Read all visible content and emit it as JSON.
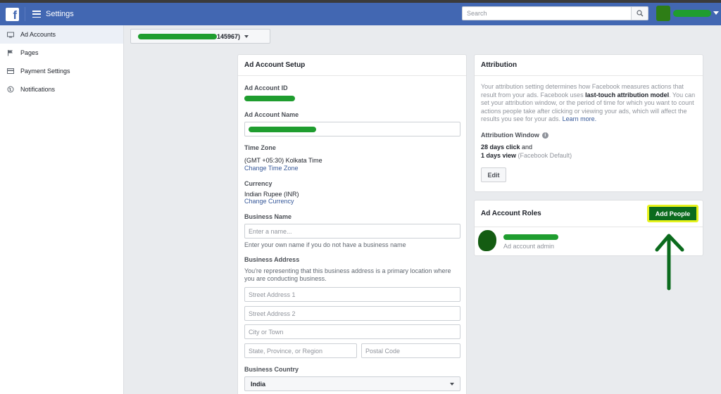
{
  "header": {
    "title": "Settings",
    "search_placeholder": "Search"
  },
  "sidebar": {
    "items": [
      {
        "label": "Ad Accounts",
        "icon": "ad-accounts-icon"
      },
      {
        "label": "Pages",
        "icon": "flag-icon"
      },
      {
        "label": "Payment Settings",
        "icon": "credit-card-icon"
      },
      {
        "label": "Notifications",
        "icon": "globe-icon"
      }
    ]
  },
  "account_selector": {
    "visible_suffix": "145967)"
  },
  "setup": {
    "title": "Ad Account Setup",
    "ad_account_id_label": "Ad Account ID",
    "ad_account_name_label": "Ad Account Name",
    "time_zone_label": "Time Zone",
    "time_zone_value": "(GMT +05:30) Kolkata Time",
    "change_time_zone": "Change Time Zone",
    "currency_label": "Currency",
    "currency_value": "Indian Rupee (INR)",
    "change_currency": "Change Currency",
    "business_name_label": "Business Name",
    "business_name_placeholder": "Enter a name...",
    "business_name_help": "Enter your own name if you do not have a business name",
    "business_address_label": "Business Address",
    "business_address_help": "You're representing that this business address is a primary location where you are conducting business.",
    "street1_placeholder": "Street Address 1",
    "street2_placeholder": "Street Address 2",
    "city_placeholder": "City or Town",
    "state_placeholder": "State, Province, or Region",
    "postal_placeholder": "Postal Code",
    "country_label": "Business Country",
    "country_value": "India"
  },
  "attribution": {
    "title": "Attribution",
    "description_1": "Your attribution setting determines how Facebook measures actions that result from your ads. Facebook uses ",
    "description_bold": "last-touch attribution model",
    "description_2": ". You can set your attribution window, or the period of time for which you want to count actions people take after clicking or viewing your ads, which will affect the results you see for your ads. ",
    "learn_more": "Learn more.",
    "window_label": "Attribution Window",
    "click_bold": "28 days click",
    "click_rest": " and",
    "view_bold": "1 days view",
    "view_rest": " (Facebook Default)",
    "edit_label": "Edit"
  },
  "roles": {
    "title": "Ad Account Roles",
    "add_people_label": "Add People",
    "member_role": "Ad account admin"
  },
  "colors": {
    "brand_blue": "#4267b2",
    "link_blue": "#365899",
    "highlight_yellow": "#e6f21c",
    "annotation_green": "#0b6b1d"
  }
}
